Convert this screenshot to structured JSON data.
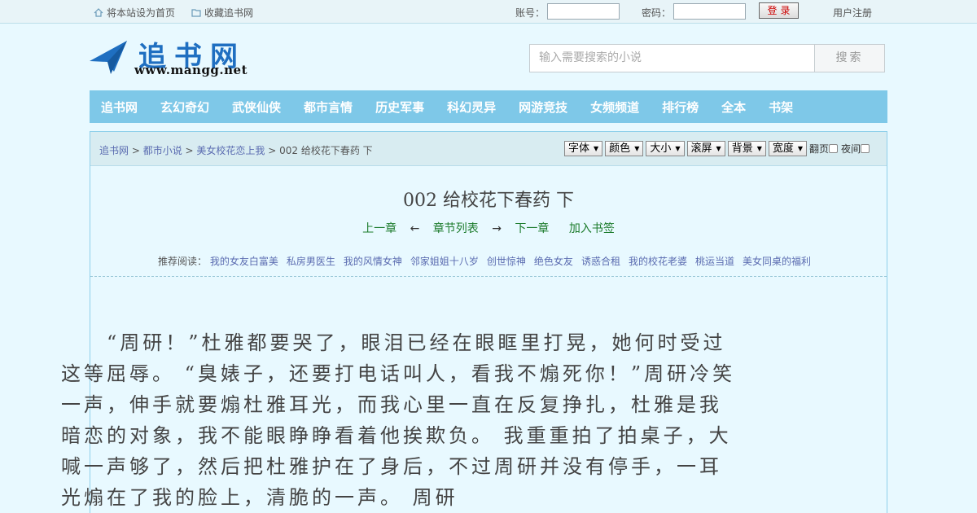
{
  "topbar": {
    "set_home": "将本站设为首页",
    "bookmark": "收藏追书网",
    "account_label": "账号：",
    "password_label": "密码：",
    "login_button": "登录",
    "register": "用户注册"
  },
  "header": {
    "site_name": "追书网",
    "site_url": "www.mangg.net",
    "search_placeholder": "输入需要搜索的小说",
    "search_button": "搜索"
  },
  "nav": {
    "items": [
      "追书网",
      "玄幻奇幻",
      "武侠仙侠",
      "都市言情",
      "历史军事",
      "科幻灵异",
      "网游竞技",
      "女频频道",
      "排行榜",
      "全本",
      "书架"
    ]
  },
  "breadcrumb": {
    "home": "追书网",
    "category": "都市小说",
    "book": "美女校花恋上我",
    "current": "002 给校花下春药 下"
  },
  "tools": {
    "font": "字体",
    "color": "颜色",
    "size": "大小",
    "scroll": "滚屏",
    "background": "背景",
    "width": "宽度",
    "page_turn": "翻页",
    "night": "夜间"
  },
  "chapter": {
    "title": "002 给校花下春药 下",
    "prev": "上一章",
    "list": "章节列表",
    "next": "下一章",
    "add_bookmark": "加入书签",
    "arrow_left": "←",
    "arrow_right": "→"
  },
  "recommend": {
    "label": "推荐阅读：",
    "items": [
      "我的女友白富美",
      "私房男医生",
      "我的风情女神",
      "邻家姐姐十八岁",
      "创世惊神",
      "绝色女友",
      "诱惑合租",
      "我的校花老婆",
      "桃运当道",
      "美女同桌的福利"
    ]
  },
  "content": {
    "paragraph": "“周研！”杜雅都要哭了，眼泪已经在眼眶里打晃，她何时受过这等屈辱。 “臭婊子，还要打电话叫人，看我不煽死你！”周研冷笑一声，伸手就要煽杜雅耳光，而我心里一直在反复挣扎，杜雅是我暗恋的对象，我不能眼睁睁看着他挨欺负。 我重重拍了拍桌子，大喊一声够了，然后把杜雅护在了身后，不过周研并没有停手，一耳光煽在了我的脸上，清脆的一声。 周研"
  }
}
